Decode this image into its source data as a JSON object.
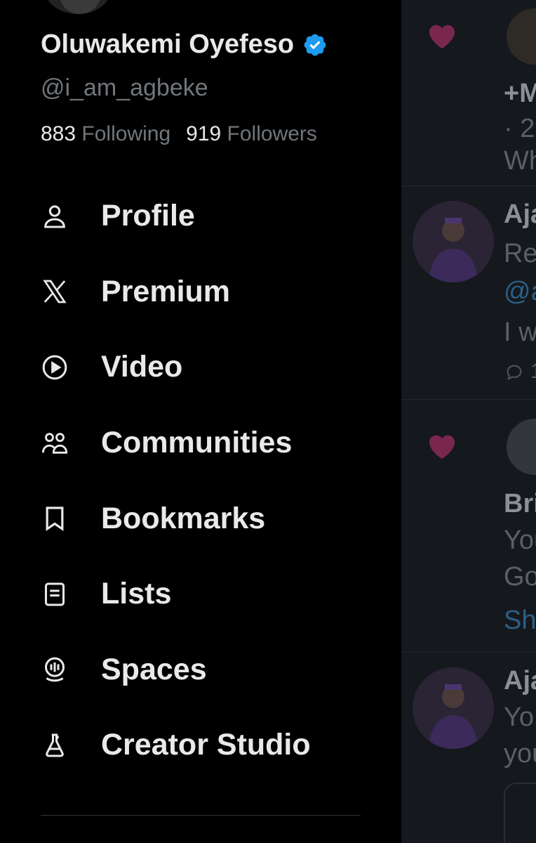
{
  "profile": {
    "display_name": "Oluwakemi Oyefeso",
    "handle": "@i_am_agbeke",
    "following_count": "883",
    "following_label": "Following",
    "followers_count": "919",
    "followers_label": "Followers",
    "verified_icon": "verified-badge-icon",
    "verified_color": "#1d9bf0"
  },
  "nav": [
    {
      "label": "Profile",
      "icon": "person-icon"
    },
    {
      "label": "Premium",
      "icon": "x-logo-icon"
    },
    {
      "label": "Video",
      "icon": "play-circle-icon"
    },
    {
      "label": "Communities",
      "icon": "communities-icon"
    },
    {
      "label": "Bookmarks",
      "icon": "bookmark-icon"
    },
    {
      "label": "Lists",
      "icon": "list-icon"
    },
    {
      "label": "Spaces",
      "icon": "spaces-mic-icon"
    },
    {
      "label": "Creator Studio",
      "icon": "flask-icon"
    }
  ],
  "timeline": {
    "like_color": "#7a2750",
    "post1": {
      "name": "+M",
      "meta": "· 2l",
      "text": "Wh"
    },
    "post2": {
      "name": "Aja",
      "line1": "Re",
      "mention": "@a",
      "line2": "I w",
      "reply_count": "1"
    },
    "post3": {
      "name": "Bri",
      "line1": "You",
      "line2": "Go",
      "show": "Sh"
    },
    "post4": {
      "name": "Aja",
      "line1": "Yo",
      "line2": "you"
    }
  },
  "colors": {
    "background": "#000000",
    "text_primary": "#e7e9ea",
    "text_secondary": "#71767b",
    "timeline_bg": "#15181c"
  }
}
